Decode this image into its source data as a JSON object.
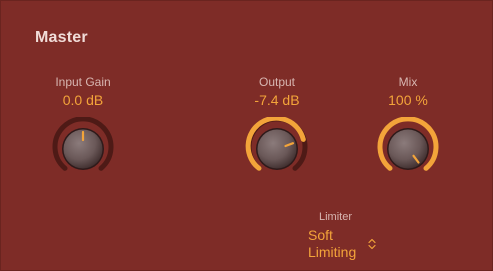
{
  "panel": {
    "title": "Master"
  },
  "knobs": {
    "input_gain": {
      "label": "Input Gain",
      "value": "0.0 dB"
    },
    "output": {
      "label": "Output",
      "value": "-7.4 dB"
    },
    "mix": {
      "label": "Mix",
      "value": "100 %"
    }
  },
  "limiter": {
    "label": "Limiter",
    "value": "Soft Limiting"
  },
  "colors": {
    "background": "#7e2c27",
    "accent": "#f3a43a",
    "track": "#4e1a16",
    "label": "#d8b6b1"
  },
  "icons": {
    "limiter_chevron": "updown-chevron-icon"
  }
}
